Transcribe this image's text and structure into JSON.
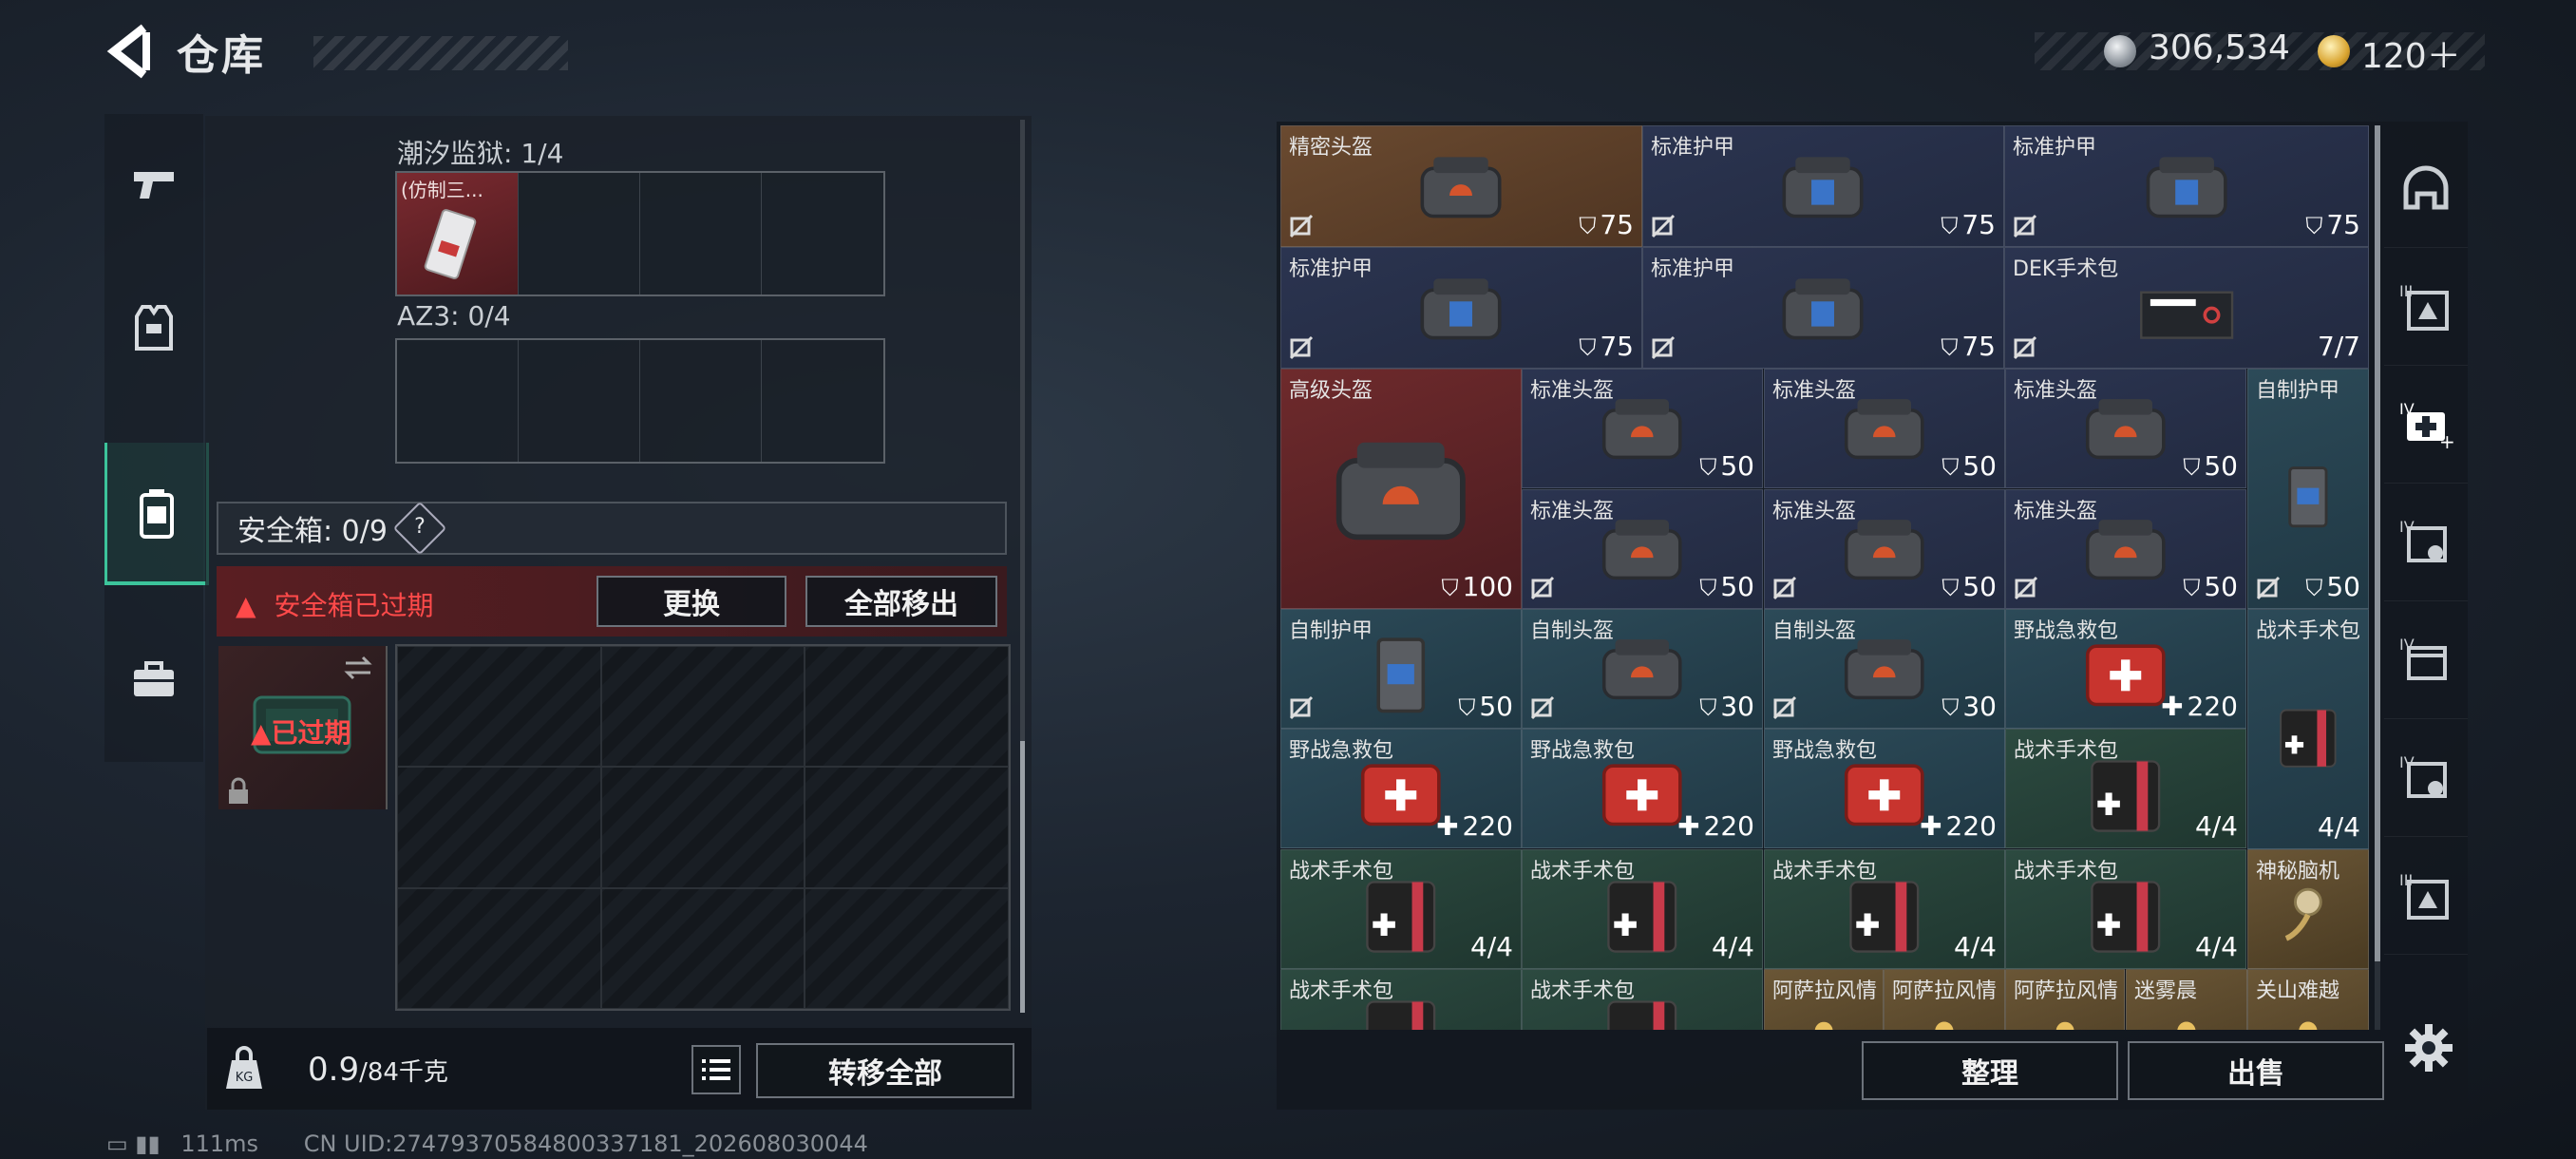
{
  "header": {
    "title": "仓库"
  },
  "currency": {
    "silver": "306,534",
    "gold": "120＋"
  },
  "nav": {
    "tabs": [
      "weapons",
      "armor",
      "containers",
      "briefcase"
    ],
    "active": 2
  },
  "sections": {
    "tide": {
      "label": "潮汐监狱: 1/4",
      "item_name": "(仿制三..."
    },
    "az3": {
      "label": "AZ3: 0/4"
    }
  },
  "safe_box": {
    "label": "安全箱: 0/9",
    "help": "?",
    "warning": "安全箱已过期",
    "replace_btn": "更换",
    "remove_all_btn": "全部移出",
    "expired_tag": "已过期"
  },
  "bottom": {
    "weight": "0.9",
    "weight_unit": "/84千克",
    "transfer_all": "转移全部",
    "sort": "整理",
    "sell": "出售",
    "bag_label": "KG"
  },
  "items": [
    {
      "name": "精密头盔",
      "value": "75",
      "bg": "orange",
      "kind": "helmet",
      "nolock": true
    },
    {
      "name": "标准护甲",
      "value": "75",
      "bg": "navy",
      "kind": "armor",
      "nolock": true
    },
    {
      "name": "标准护甲",
      "value": "75",
      "bg": "navy",
      "kind": "armor",
      "nolock": true
    },
    {
      "name": "标准护甲",
      "value": "75",
      "bg": "navy",
      "kind": "armor",
      "nolock": true
    },
    {
      "name": "标准护甲",
      "value": "75",
      "bg": "navy",
      "kind": "armor",
      "nolock": true
    },
    {
      "name": "DEK手术包",
      "value": "7/7",
      "bg": "navy",
      "kind": "kit",
      "nolock": true
    },
    {
      "name": "高级头盔",
      "value": "100",
      "bg": "red",
      "kind": "helmet",
      "nolock": false
    },
    {
      "name": "标准头盔",
      "value": "50",
      "bg": "navy",
      "kind": "helmet",
      "nolock": false
    },
    {
      "name": "标准头盔",
      "value": "50",
      "bg": "navy",
      "kind": "helmet",
      "nolock": false
    },
    {
      "name": "标准头盔",
      "value": "50",
      "bg": "navy",
      "kind": "helmet",
      "nolock": false
    },
    {
      "name": "自制护甲",
      "value": "50",
      "bg": "teal",
      "kind": "vest",
      "nolock": true
    },
    {
      "name": "标准头盔",
      "value": "50",
      "bg": "navy",
      "kind": "helmet",
      "nolock": true
    },
    {
      "name": "标准头盔",
      "value": "50",
      "bg": "navy",
      "kind": "helmet",
      "nolock": true
    },
    {
      "name": "标准头盔",
      "value": "50",
      "bg": "navy",
      "kind": "helmet",
      "nolock": true
    },
    {
      "name": "自制护甲",
      "value": "50",
      "bg": "teal",
      "kind": "vest",
      "nolock": true
    },
    {
      "name": "自制头盔",
      "value": "30",
      "bg": "teal",
      "kind": "helmet",
      "nolock": true
    },
    {
      "name": "自制头盔",
      "value": "30",
      "bg": "teal",
      "kind": "helmet",
      "nolock": true
    },
    {
      "name": "野战急救包",
      "value": "220",
      "bg": "teal",
      "kind": "medkit",
      "nolock": false
    },
    {
      "name": "战术手术包",
      "value": "4/4",
      "bg": "teal",
      "kind": "pouch",
      "nolock": false
    },
    {
      "name": "野战急救包",
      "value": "220",
      "bg": "teal",
      "kind": "medkit",
      "nolock": false
    },
    {
      "name": "野战急救包",
      "value": "220",
      "bg": "teal",
      "kind": "medkit",
      "nolock": false
    },
    {
      "name": "野战急救包",
      "value": "220",
      "bg": "teal",
      "kind": "medkit",
      "nolock": false
    },
    {
      "name": "战术手术包",
      "value": "4/4",
      "bg": "green",
      "kind": "pouch",
      "nolock": false
    },
    {
      "name": "战术手术包",
      "value": "4/4",
      "bg": "green",
      "kind": "pouch",
      "nolock": false
    },
    {
      "name": "战术手术包",
      "value": "4/4",
      "bg": "green",
      "kind": "pouch",
      "nolock": false
    },
    {
      "name": "战术手术包",
      "value": "4/4",
      "bg": "green",
      "kind": "pouch",
      "nolock": false
    },
    {
      "name": "战术手术包",
      "value": "4/4",
      "bg": "green",
      "kind": "pouch",
      "nolock": false
    },
    {
      "name": "神秘脑机",
      "value": "",
      "bg": "gold",
      "kind": "brain",
      "nolock": false
    },
    {
      "name": "战术手术包",
      "value": "",
      "bg": "green",
      "kind": "pouch",
      "nolock": false
    },
    {
      "name": "战术手术包",
      "value": "",
      "bg": "green",
      "kind": "pouch",
      "nolock": false
    },
    {
      "name": "阿萨拉风情",
      "value": "",
      "bg": "gold",
      "kind": "deco",
      "nolock": false
    },
    {
      "name": "阿萨拉风情",
      "value": "",
      "bg": "gold",
      "kind": "deco",
      "nolock": false
    },
    {
      "name": "阿萨拉风情",
      "value": "",
      "bg": "gold",
      "kind": "deco",
      "nolock": false
    },
    {
      "name": "迷雾晨",
      "value": "",
      "bg": "gold",
      "kind": "deco",
      "nolock": false
    },
    {
      "name": "关山难越",
      "value": "",
      "bg": "gold",
      "kind": "deco",
      "nolock": false
    }
  ],
  "side_filters": [
    "helmet-filter",
    "armor-III-filter",
    "medkit-IV-filter",
    "rig-IV-filter",
    "pouch-IV-filter",
    "rig-IV-filter-2",
    "armor-III-filter-2"
  ],
  "status": {
    "ping": "111ms",
    "uid": "CN UID:2747937058480033718‌1_202608030044"
  }
}
